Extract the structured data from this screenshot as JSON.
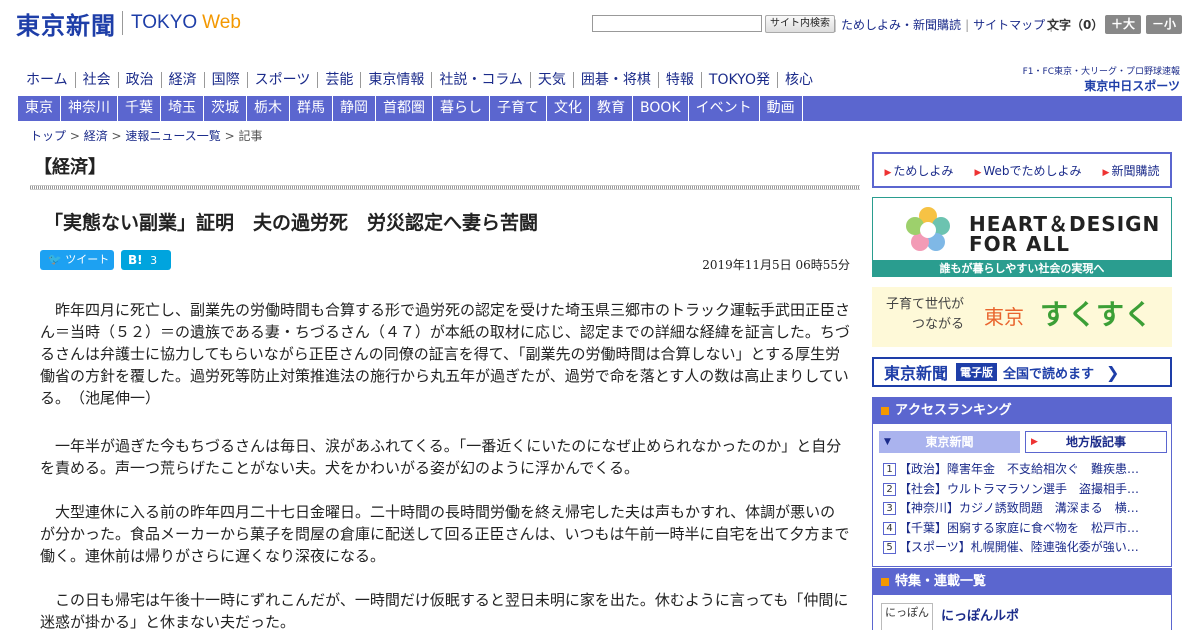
{
  "header": {
    "logo_kanji": "東京新聞",
    "logo_tokyo": "TOKYO",
    "logo_web": "Web",
    "search_button": "サイト内検索",
    "top_links": [
      "ためしよみ・新聞購読",
      "サイトマップ"
    ],
    "font_size_label": "文字（0）",
    "font_larger": "＋大",
    "font_smaller": "－小"
  },
  "nav_main": [
    "ホーム",
    "社会",
    "政治",
    "経済",
    "国際",
    "スポーツ",
    "芸能",
    "東京情報",
    "社説・コラム",
    "天気",
    "囲碁・将棋",
    "特報",
    "TOKYO発",
    "核心"
  ],
  "chunichi_sports": {
    "small": "F1・FC東京・大リーグ・プロ野球速報",
    "name": "東京中日スポーツ"
  },
  "nav_local": [
    "東京",
    "神奈川",
    "千葉",
    "埼玉",
    "茨城",
    "栃木",
    "群馬",
    "静岡",
    "首都圏",
    "暮らし",
    "子育て",
    "文化",
    "教育",
    "BOOK",
    "イベント",
    "動画"
  ],
  "breadcrumb": {
    "items": [
      "トップ",
      "経済",
      "速報ニュース一覧"
    ],
    "current": "記事",
    "sep": " > "
  },
  "article": {
    "section": "【経済】",
    "headline": "「実態ない副業」証明　夫の過労死　労災認定へ妻ら苦闘",
    "tweet_label": "ツイート",
    "hatena_label": "B!",
    "hatena_count": "3",
    "date": "2019年11月5日 06時55分",
    "paragraphs": [
      "　昨年四月に死亡し、副業先の労働時間も合算する形で過労死の認定を受けた埼玉県三郷市のトラック運転手武田正臣さん＝当時（５２）＝の遺族である妻・ちづるさん（４７）が本紙の取材に応じ、認定までの詳細な経緯を証言した。ちづるさんは弁護士に協力してもらいながら正臣さんの同僚の証言を得て、「副業先の労働時間は合算しない」とする厚生労働省の方針を覆した。過労死等防止対策推進法の施行から丸五年が過ぎたが、過労で命を落とす人の数は高止まりしている。　（池尾伸一）",
      "　一年半が過ぎた今もちづるさんは毎日、涙があふれてくる。「一番近くにいたのになぜ止められなかったのか」と自分を責める。声一つ荒らげたことがない夫。犬をかわいがる姿が幻のように浮かんでくる。",
      "　大型連休に入る前の昨年四月二十七日金曜日。二十時間の長時間労働を終え帰宅した夫は声もかすれ、体調が悪いのが分かった。食品メーカーから菓子を問屋の倉庫に配送して回る正臣さんは、いつもは午前一時半に自宅を出て夕方まで働く。連休前は帰りがさらに遅くなり深夜になる。",
      "　この日も帰宅は午後十一時にずれこんだが、一時間だけ仮眠すると翌日未明に家を出た。休むように言っても「仲間に迷惑が掛かる」と休まない夫だった。"
    ]
  },
  "sidebar": {
    "buttons": [
      "ためしよみ",
      "Webでためしよみ",
      "新聞購読"
    ],
    "heart_title_1": "HEART＆DESIGN",
    "heart_title_2": "FOR ALL",
    "heart_strip": "誰もが暮らしやすい社会の実現へ",
    "sukusuku_line1": "子育て世代が",
    "sukusuku_line2": "つながる",
    "sukusuku_tokyo": "東京",
    "sukusuku_big": "すくすく",
    "denshi_kanji": "東京新聞",
    "denshi_badge": "電子版",
    "denshi_text": "全国で読めます",
    "ranking_title": "アクセスランキング",
    "ranking_tab_a": "東京新聞",
    "ranking_tab_b": "地方版記事",
    "ranking_items": [
      {
        "num": "1",
        "text": "【政治】障害年金　不支給相次ぐ　難疾患…"
      },
      {
        "num": "2",
        "text": "【社会】ウルトラマラソン選手　盗撮相手…"
      },
      {
        "num": "3",
        "text": "【神奈川】カジノ誘致問題　溝深まる　横…"
      },
      {
        "num": "4",
        "text": "【千葉】困窮する家庭に食べ物を　松戸市…"
      },
      {
        "num": "5",
        "text": "【スポーツ】札幌開催、陸連強化委が強い…"
      }
    ],
    "tokushu_title": "特集・連載一覧",
    "tokushu_thumb": "にっぽん",
    "tokushu_item": "にっぽんルポ"
  },
  "colors": {
    "brand_blue": "#1e3ea8",
    "nav_purple": "#5b66cf",
    "web_orange": "#f39800",
    "teal": "#2a9d8f"
  }
}
